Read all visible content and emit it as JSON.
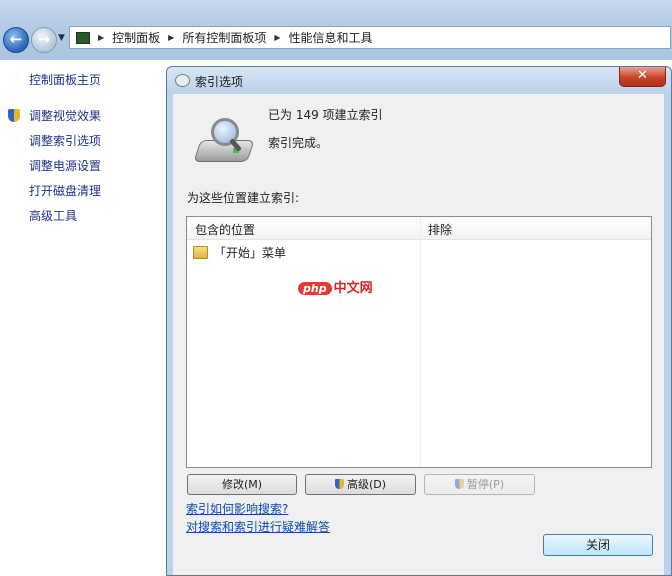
{
  "explorer": {
    "address_crumbs": [
      "控制面板",
      "所有控制面板项",
      "性能信息和工具"
    ]
  },
  "leftnav": {
    "home": "控制面板主页",
    "items": [
      "调整视觉效果",
      "调整索引选项",
      "调整电源设置",
      "打开磁盘清理",
      "高级工具"
    ]
  },
  "dialog": {
    "title": "索引选项",
    "close_glyph": "✕",
    "indexed_summary": "已为 149 项建立索引",
    "status": "索引完成。",
    "locations_label": "为这些位置建立索引:",
    "columns": {
      "included": "包含的位置",
      "excluded": "排除"
    },
    "rows": [
      {
        "included": "「开始」菜单",
        "excluded": ""
      }
    ],
    "watermark": {
      "badge": "php",
      "text": "中文网"
    },
    "buttons": {
      "modify": "修改(M)",
      "advanced": "高级(D)",
      "pause": "暂停(P)",
      "close": "关闭"
    },
    "links": {
      "how_affects": "索引如何影响搜索?",
      "troubleshoot": "对搜索和索引进行疑难解答"
    }
  }
}
